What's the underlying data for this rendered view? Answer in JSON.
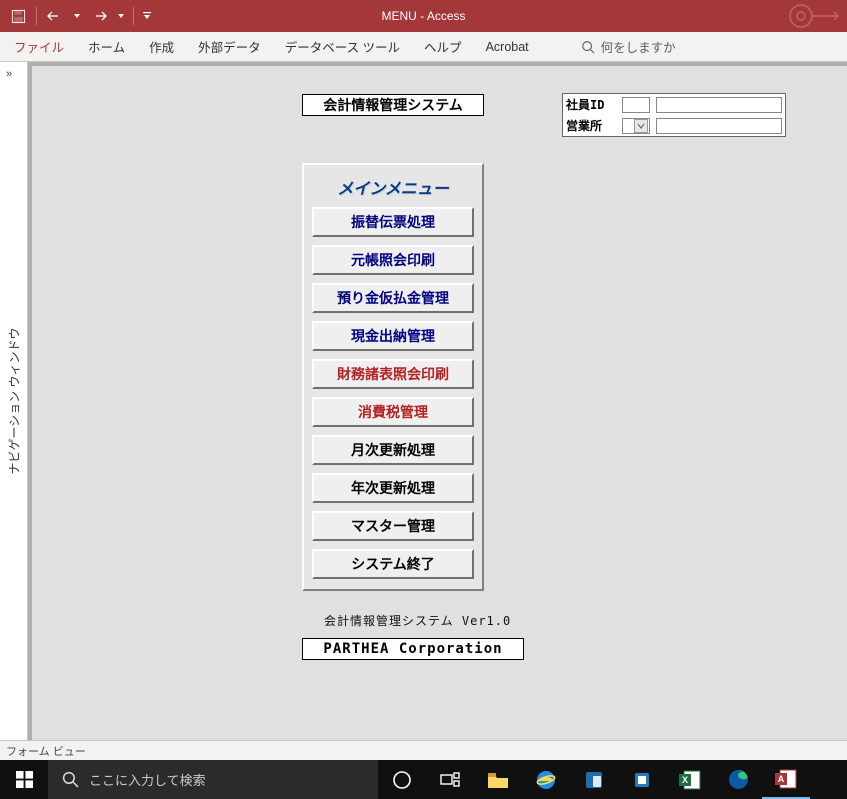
{
  "titlebar": {
    "title": "MENU  -  Access"
  },
  "ribbon": {
    "tabs": [
      "ファイル",
      "ホーム",
      "作成",
      "外部データ",
      "データベース ツール",
      "ヘルプ",
      "Acrobat"
    ],
    "search_placeholder": "何をしますか"
  },
  "navpane": {
    "label": "ナビゲーション ウィンドウ"
  },
  "form": {
    "system_title": "会計情報管理システム",
    "fields": {
      "employee_label": "社員ID",
      "employee_value": "",
      "office_label": "営業所",
      "office_value": ""
    },
    "menu_title": "メインメニュー",
    "menu": [
      {
        "label": "振替伝票処理",
        "style": "navy"
      },
      {
        "label": "元帳照会印刷",
        "style": "navy"
      },
      {
        "label": "預り金仮払金管理",
        "style": "navy"
      },
      {
        "label": "現金出納管理",
        "style": "navy"
      },
      {
        "label": "財務諸表照会印刷",
        "style": "red"
      },
      {
        "label": "消費税管理",
        "style": "red"
      },
      {
        "label": "月次更新処理",
        "style": "black"
      },
      {
        "label": "年次更新処理",
        "style": "black"
      },
      {
        "label": "マスター管理",
        "style": "black"
      },
      {
        "label": "システム終了",
        "style": "black"
      }
    ],
    "version": "会計情報管理システム Ver1.0",
    "company": "PARTHEA Corporation"
  },
  "statusbar": {
    "text": "フォーム ビュー"
  },
  "taskbar": {
    "search_placeholder": "ここに入力して検索"
  }
}
